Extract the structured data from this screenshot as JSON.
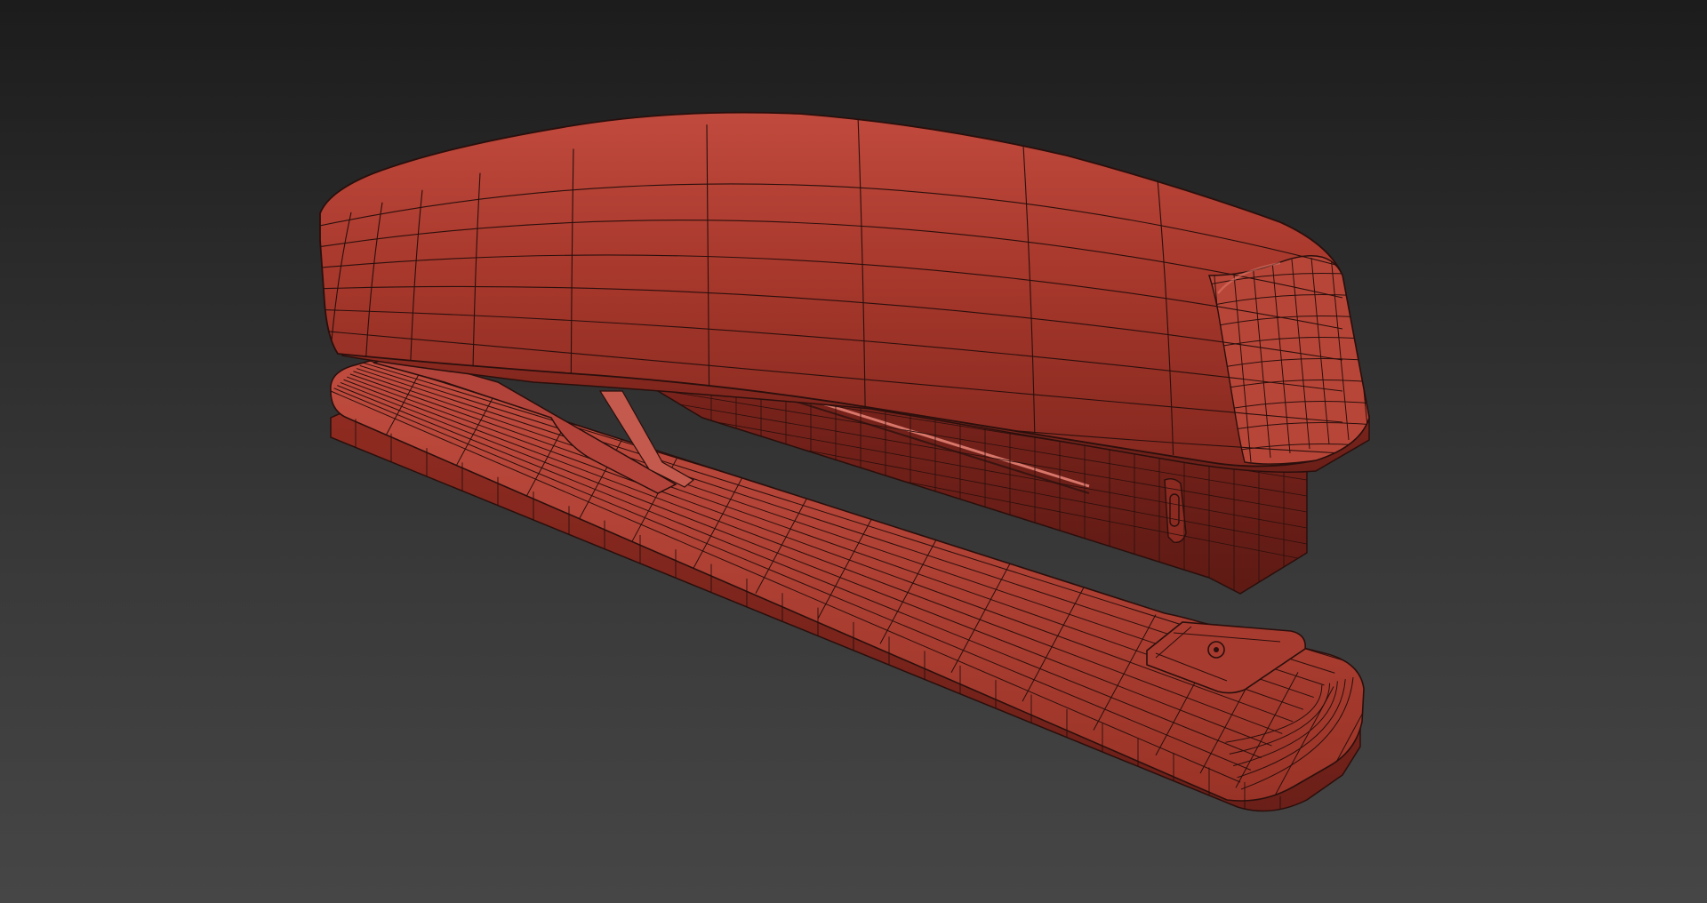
{
  "viewport": {
    "background_top": "#1c1c1c",
    "background_bottom": "#464646"
  },
  "model": {
    "object": "stapler",
    "display_mode": "wireframe-on-shaded",
    "material_color": "#a8382c",
    "highlight_color": "#c85446",
    "shadow_color": "#6e2019",
    "wire_color": "#2a0f0c",
    "parts": [
      "top-arm",
      "base-plate",
      "magazine",
      "hinge-post",
      "anvil-plate"
    ]
  }
}
